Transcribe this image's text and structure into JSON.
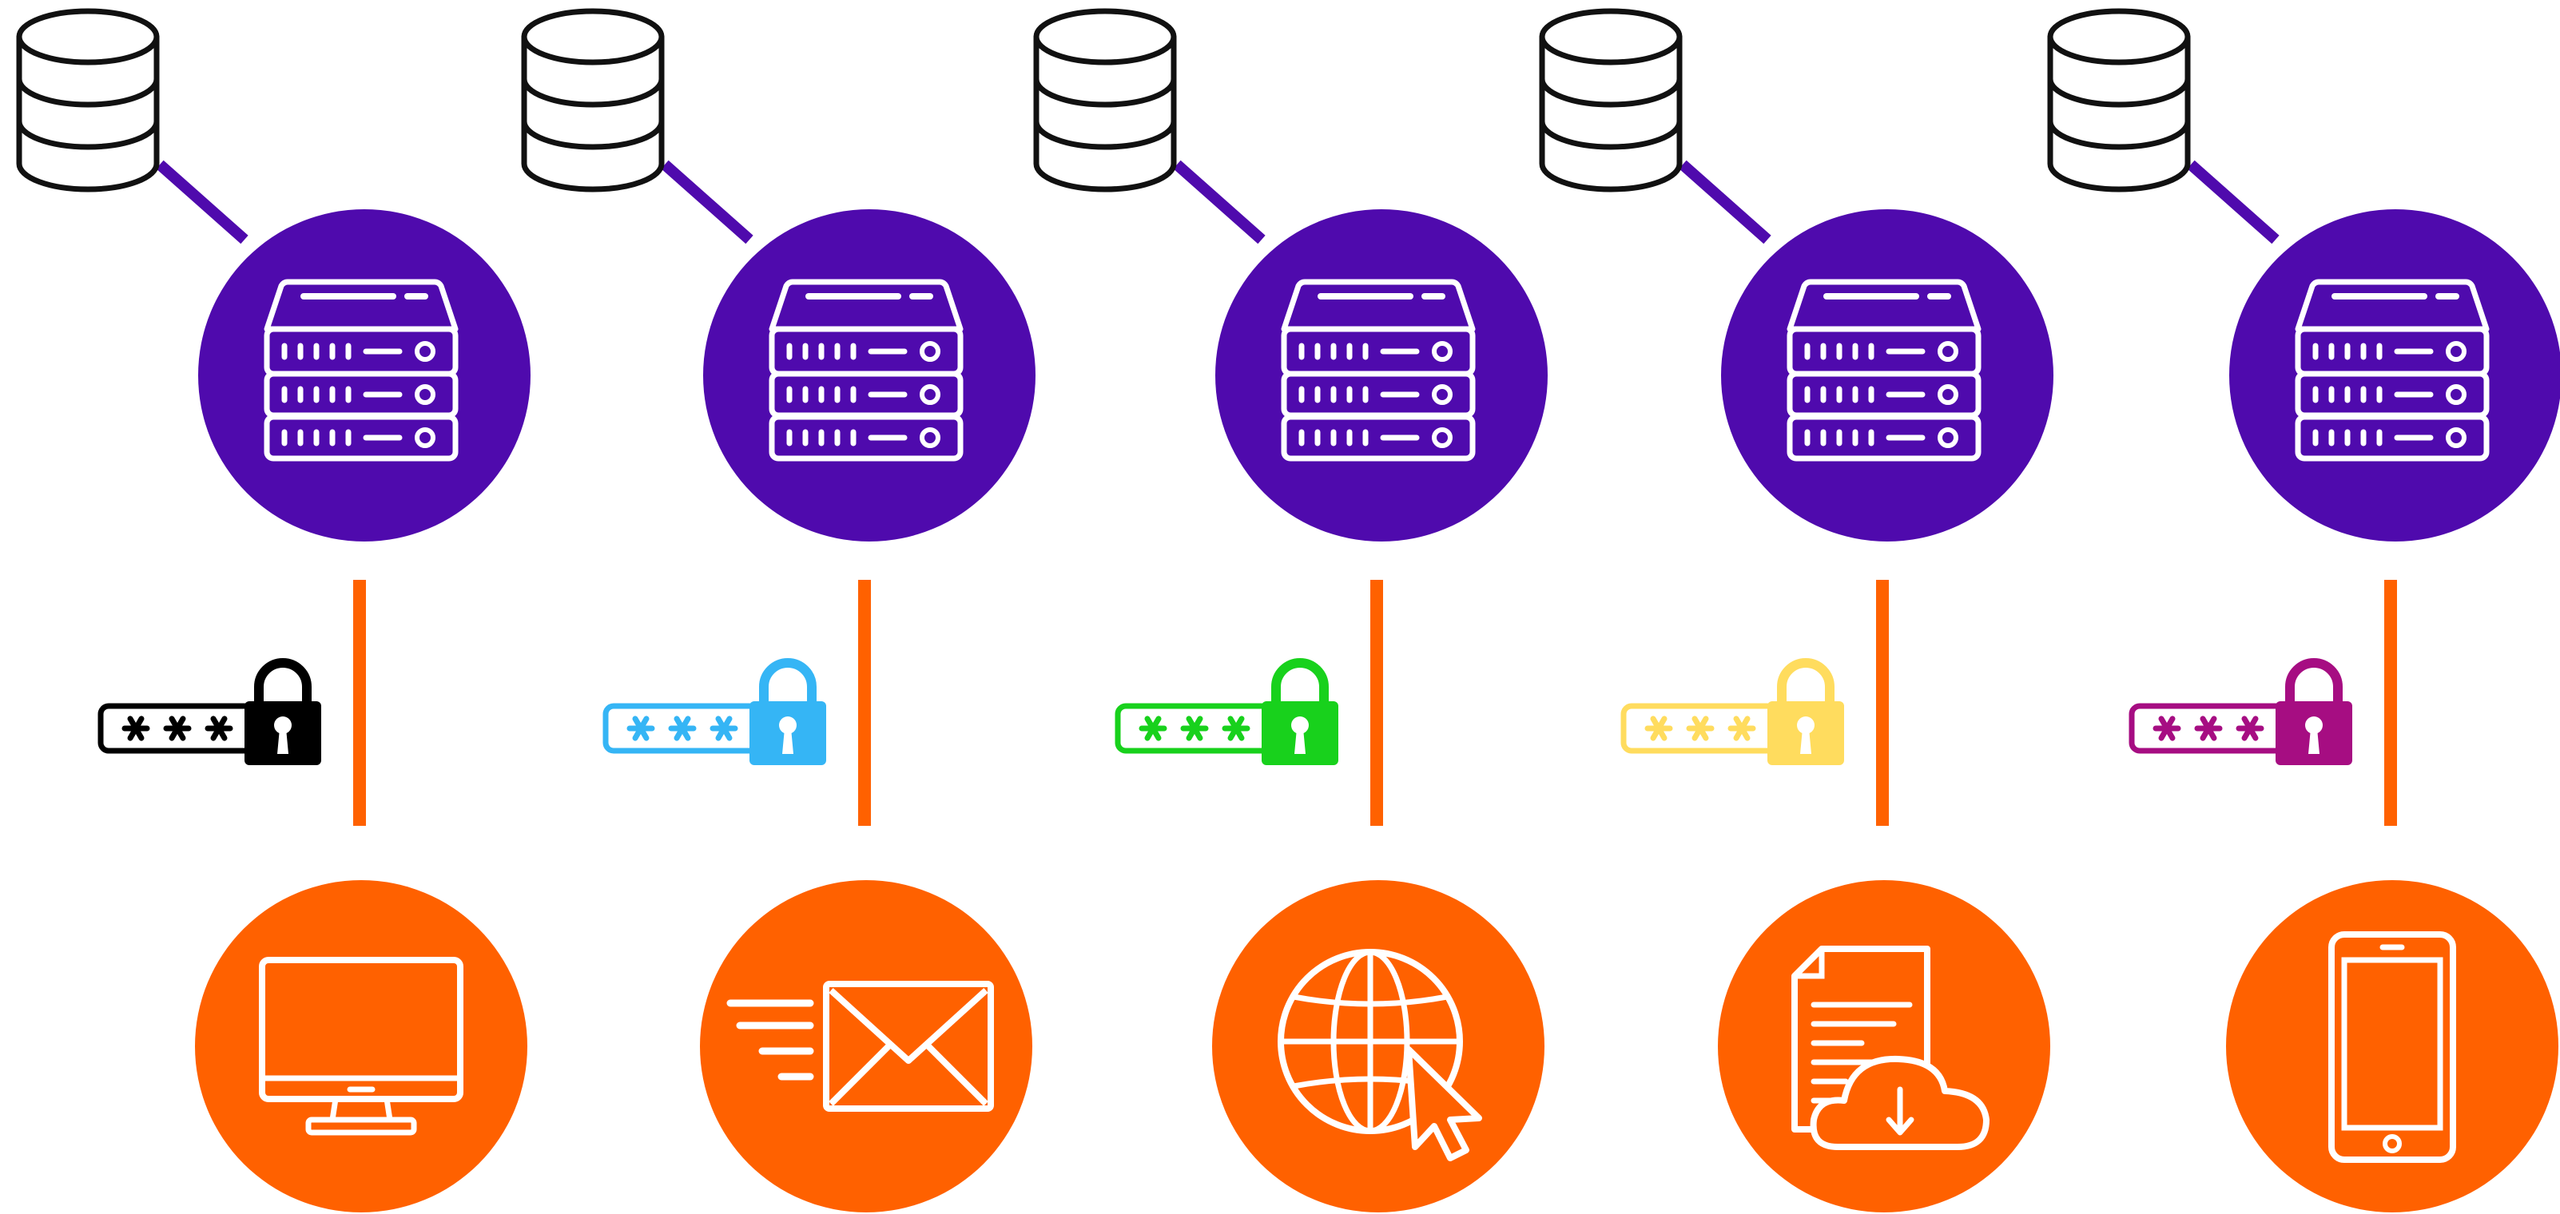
{
  "colors": {
    "background": "#ffffff",
    "server_circle": "#4f0aad",
    "connector_db": "#4f0aad",
    "connector_link": "#ff6100",
    "client_circle": "#ff6100",
    "icon_stroke": "#ffffff",
    "database_stroke": "#111111",
    "database_fill": "#ffffff"
  },
  "columns": [
    {
      "id": "desktop",
      "database_icon": "database-icon",
      "server_icon": "server-rack-icon",
      "password_icon": "password-lock-icon",
      "password_color": "#000000",
      "password_mask": "***",
      "client_icon": "desktop-monitor-icon"
    },
    {
      "id": "email",
      "database_icon": "database-icon",
      "server_icon": "server-rack-icon",
      "password_icon": "password-lock-icon",
      "password_color": "#35b5f5",
      "password_mask": "***",
      "client_icon": "email-envelope-icon"
    },
    {
      "id": "web",
      "database_icon": "database-icon",
      "server_icon": "server-rack-icon",
      "password_icon": "password-lock-icon",
      "password_color": "#18d11c",
      "password_mask": "***",
      "client_icon": "globe-cursor-icon"
    },
    {
      "id": "cloud-document",
      "database_icon": "database-icon",
      "server_icon": "server-rack-icon",
      "password_icon": "password-lock-icon",
      "password_color": "#ffdc5e",
      "password_mask": "***",
      "client_icon": "document-cloud-download-icon"
    },
    {
      "id": "mobile",
      "database_icon": "database-icon",
      "server_icon": "server-rack-icon",
      "password_icon": "password-lock-icon",
      "password_color": "#a60d82",
      "password_mask": "***",
      "client_icon": "smartphone-icon"
    }
  ]
}
